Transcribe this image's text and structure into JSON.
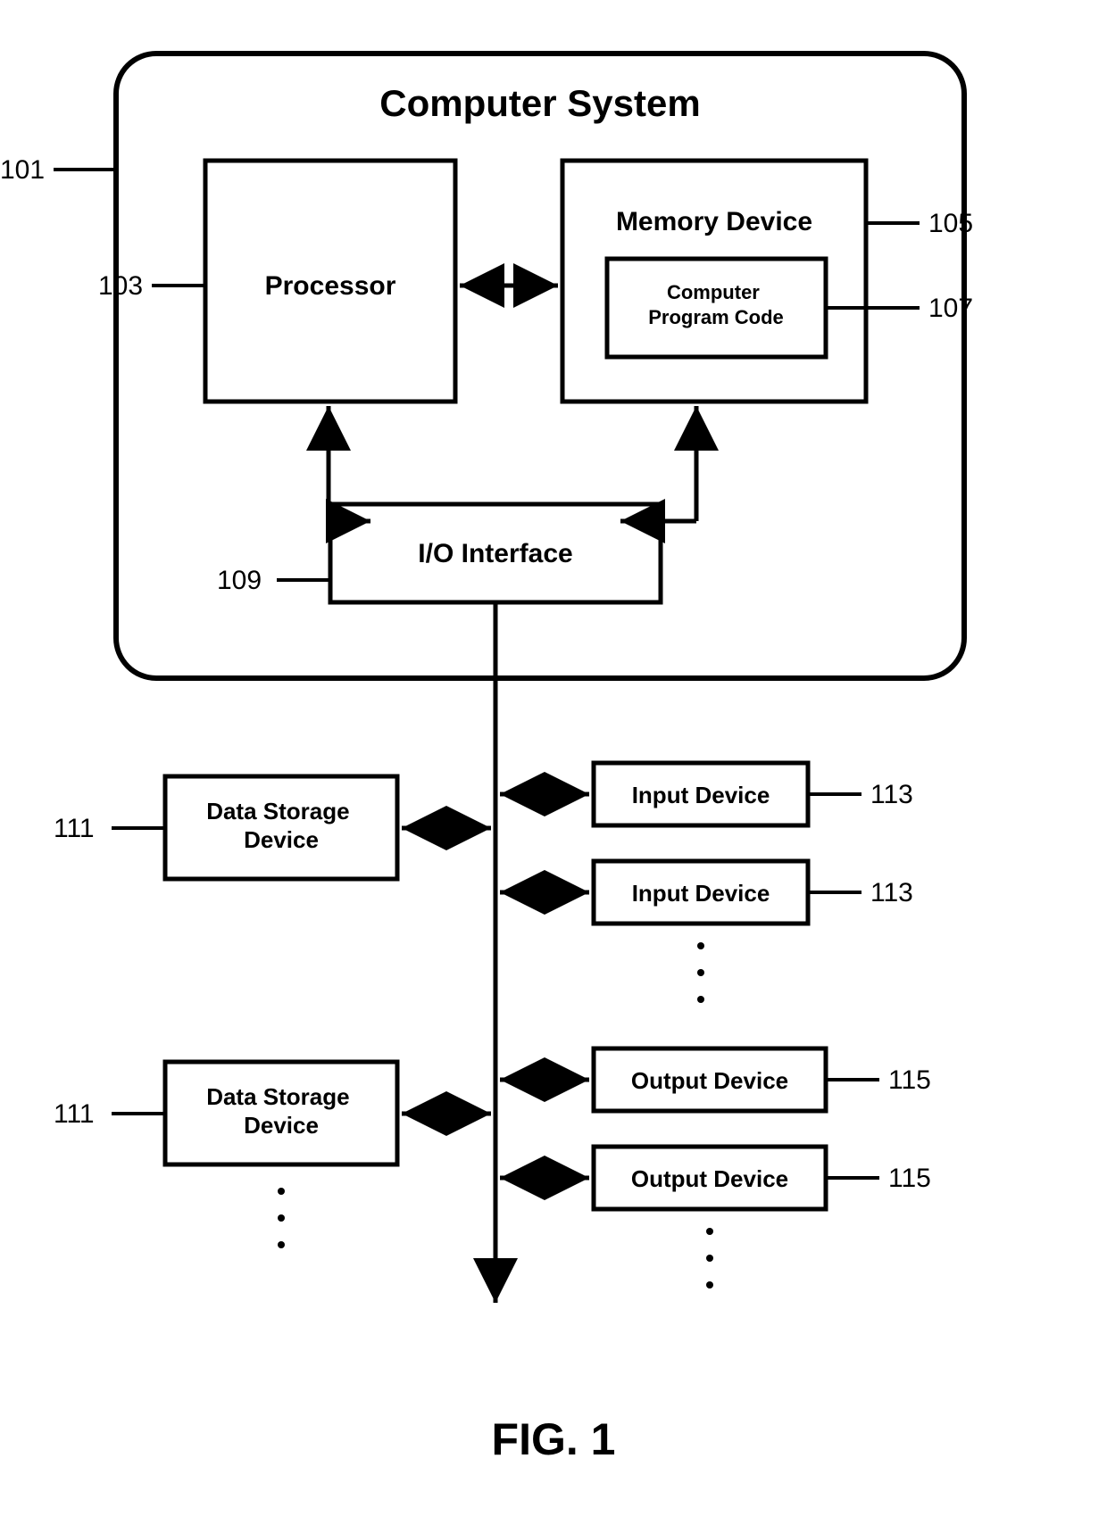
{
  "diagram": {
    "title": "Computer System",
    "processor": "Processor",
    "memory": "Memory Device",
    "program": "Computer Program Code",
    "io": "I/O Interface",
    "storage": "Data Storage Device",
    "input": "Input Device",
    "output": "Output Device",
    "caption": "FIG. 1"
  },
  "refs": {
    "system": "101",
    "processor": "103",
    "memory": "105",
    "program": "107",
    "io": "109",
    "storage": "111",
    "input": "113",
    "output": "115"
  }
}
